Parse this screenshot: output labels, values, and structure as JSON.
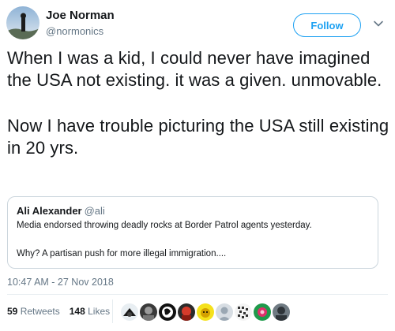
{
  "author": {
    "name": "Joe Norman",
    "handle": "@normonics"
  },
  "follow_button": {
    "label": "Follow"
  },
  "icons": {
    "menu": "chevron-down-icon",
    "avatar": "user-avatar"
  },
  "tweet": {
    "paragraphs": [
      "When I was a kid, I could never have imagined the USA not existing. it was a given. unmovable.",
      "Now I have trouble picturing the USA still existing in 20 yrs."
    ]
  },
  "quoted_tweet": {
    "name": "Ali Alexander",
    "handle": "@ali",
    "lines": [
      "Media endorsed throwing deadly rocks at Border Patrol agents yesterday.",
      "Why? A partisan push for more illegal immigration...."
    ]
  },
  "timestamp": "10:47 AM - 27 Nov 2018",
  "stats": {
    "retweets_count": "59",
    "retweets_label": "Retweets",
    "likes_count": "148",
    "likes_label": "Likes"
  },
  "colors": {
    "accent": "#1da1f2",
    "text": "#14171a",
    "muted": "#657786",
    "border": "#ccd6dd"
  }
}
